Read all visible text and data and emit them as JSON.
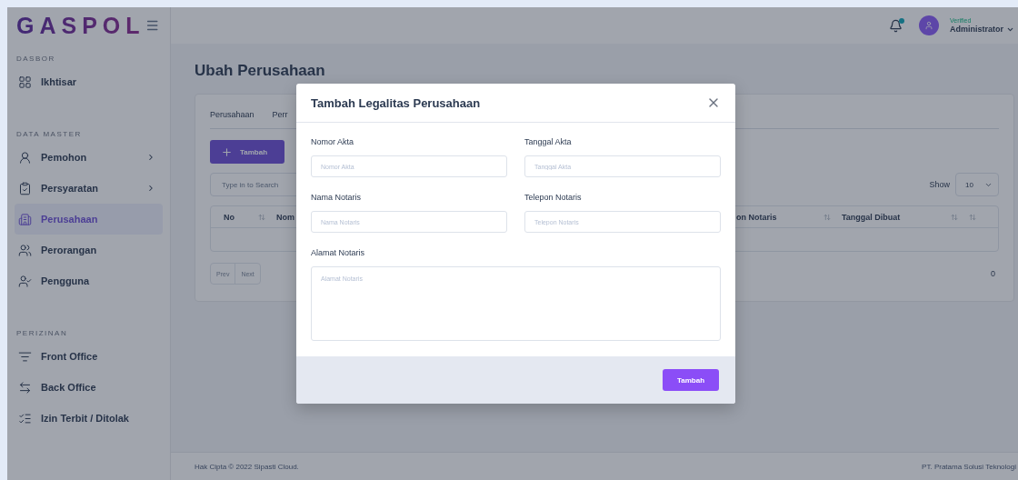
{
  "sidebar": {
    "logo": "GASPOL",
    "sections": [
      {
        "title": "DASBOR",
        "items": [
          {
            "label": "Ikhtisar",
            "selected": false,
            "submenu": false
          }
        ]
      },
      {
        "title": "DATA MASTER",
        "items": [
          {
            "label": "Pemohon",
            "selected": false,
            "submenu": true
          },
          {
            "label": "Persyaratan",
            "selected": false,
            "submenu": true
          },
          {
            "label": "Perusahaan",
            "selected": true,
            "submenu": false
          },
          {
            "label": "Perorangan",
            "selected": false,
            "submenu": false
          },
          {
            "label": "Pengguna",
            "selected": false,
            "submenu": false
          }
        ]
      },
      {
        "title": "PERIZINAN",
        "items": [
          {
            "label": "Front Office",
            "selected": false,
            "submenu": false
          },
          {
            "label": "Back Office",
            "selected": false,
            "submenu": false
          },
          {
            "label": "Izin Terbit / Ditolak",
            "selected": false,
            "submenu": false
          }
        ]
      }
    ]
  },
  "header": {
    "user_status": "Verified",
    "user_name": "Administrator",
    "notification": true
  },
  "page": {
    "title": "Ubah Perusahaan",
    "tabs": [
      "Perusahaan",
      "Perr"
    ],
    "add_button": "Tambah",
    "search": {
      "placeholder": "Type in to Search"
    },
    "show_label": "Show",
    "show_value": "10",
    "table": {
      "columns": [
        {
          "label": "No",
          "sort": true
        },
        {
          "label": "Nom"
        },
        {
          "label": "on Notaris",
          "sort": true
        },
        {
          "label": "Tanggal Dibuat",
          "sort": true
        }
      ]
    },
    "pagination": [
      "Prev",
      "Next"
    ],
    "count": "0"
  },
  "modal": {
    "title": "Tambah Legalitas Perusahaan",
    "fields": [
      {
        "kind": "input",
        "label": "Nomor Akta",
        "placeholder": "Nomor Akta"
      },
      {
        "kind": "input",
        "label": "Tanggal Akta",
        "placeholder": "Tanggal Akta"
      },
      {
        "kind": "input",
        "label": "Nama Notaris",
        "placeholder": "Nama Notaris"
      },
      {
        "kind": "input",
        "label": "Telepon Notaris",
        "placeholder": "Telepon Notaris"
      },
      {
        "kind": "textarea",
        "label": "Alamat Notaris",
        "placeholder": "Alamat Notaris"
      }
    ],
    "submit": "Tambah"
  },
  "footer": {
    "left": "Hak Cipta © 2022 Sipasti Cloud.",
    "right": "PT. Pratama Solusi Teknologi"
  }
}
